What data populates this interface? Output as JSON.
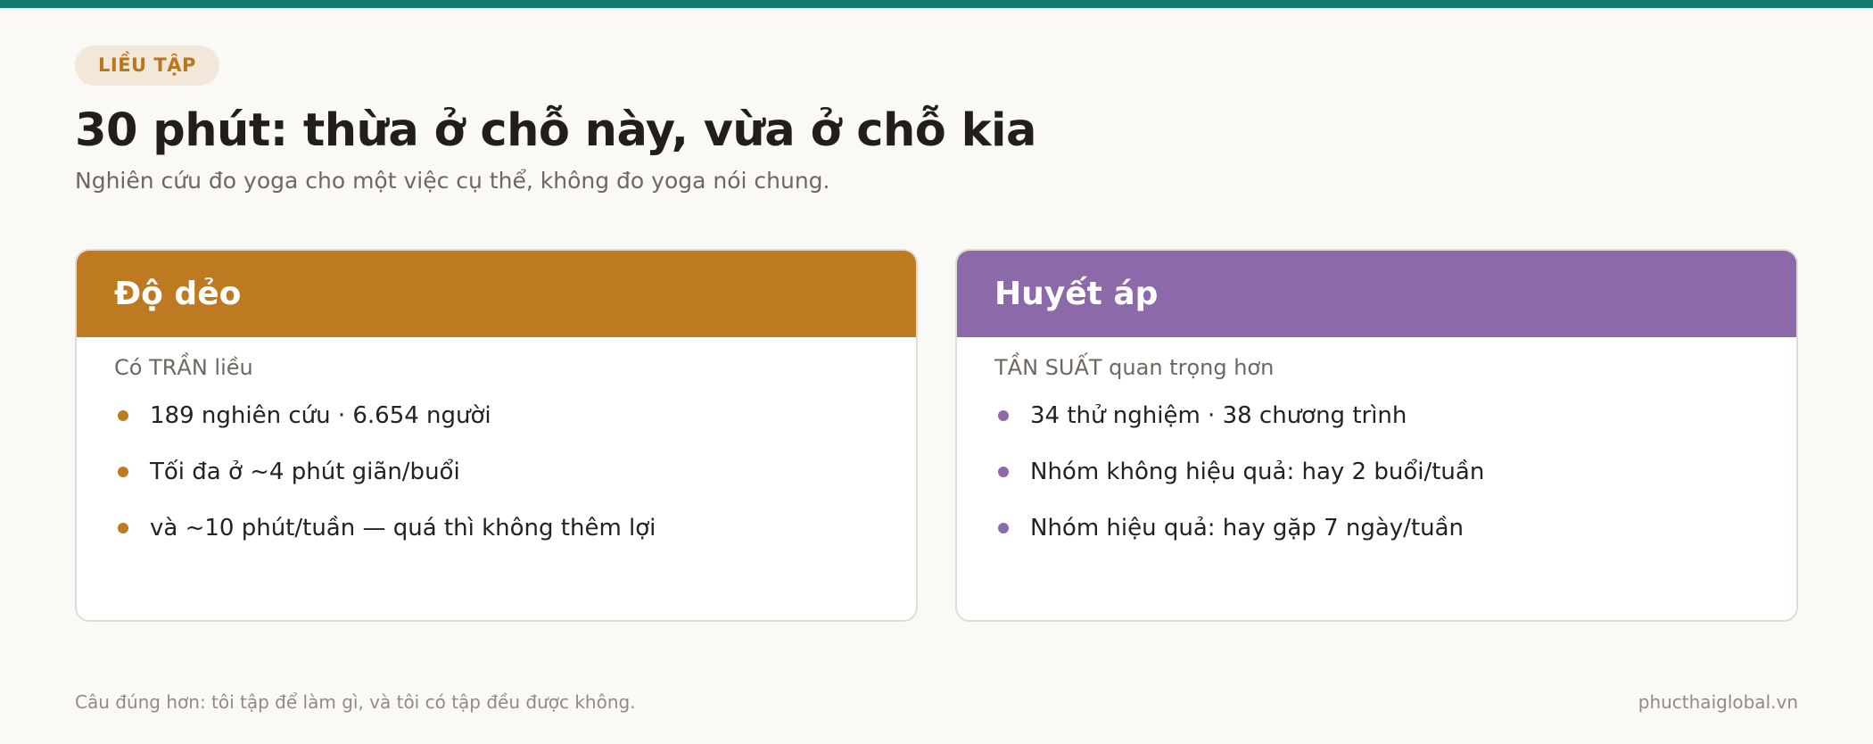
{
  "header": {
    "tag": "LIỀU TẬP",
    "title": "30 phút: thừa ở chỗ này, vừa ở chỗ kia",
    "subtitle": "Nghiên cứu đo yoga cho một việc cụ thể, không đo yoga nói chung."
  },
  "cards": [
    {
      "title": "Độ dẻo",
      "subtitle": "Có TRẦN liều",
      "accent": "#be7a21",
      "items": [
        "189 nghiên cứu · 6.654 người",
        "Tối đa ở ~4 phút giãn/buổi",
        "và ~10 phút/tuần — quá thì không thêm lợi"
      ]
    },
    {
      "title": "Huyết áp",
      "subtitle": "TẦN SUẤT quan trọng hơn",
      "accent": "#8c69a8",
      "items": [
        "34 thử nghiệm · 38 chương trình",
        "Nhóm không hiệu quả: hay 2 buổi/tuần",
        "Nhóm hiệu quả: hay gặp 7 ngày/tuần"
      ]
    }
  ],
  "footer": {
    "note": "Câu đúng hơn: tôi tập để làm gì, và tôi có tập đều được không.",
    "site": "phucthaiglobal.vn"
  },
  "colors": {
    "top_bar": "#127a6c",
    "background": "#faf9f6",
    "tag_bg": "#f2e7d8",
    "tag_text": "#b9761f"
  }
}
